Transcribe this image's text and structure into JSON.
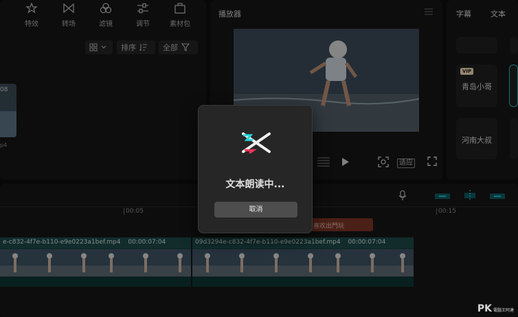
{
  "media": {
    "tools": [
      {
        "label": "特效",
        "icon": "sparkle-icon"
      },
      {
        "label": "转场",
        "icon": "transition-icon"
      },
      {
        "label": "滤镜",
        "icon": "filter-icon"
      },
      {
        "label": "调节",
        "icon": "sliders-icon"
      },
      {
        "label": "素材包",
        "icon": "package-icon"
      }
    ],
    "sort_label": "排序",
    "filter_label": "全部",
    "thumb_duration": "08",
    "thumb_name": "p4"
  },
  "player": {
    "title": "播放器",
    "fit_label": "适应"
  },
  "text_panel": {
    "tabs": [
      "字幕",
      "文本"
    ],
    "vip_badge": "VIP",
    "voices": [
      "青岛小哥",
      "河南大叔"
    ]
  },
  "timeline": {
    "ticks": [
      "00:05",
      "00:15"
    ],
    "text_clip_label": "喜欢出門玩",
    "clips": [
      {
        "name": "e-c832-4f7e-b110-e9e0223a1bef.mp4",
        "duration": "00:00:07:04"
      },
      {
        "name": "09d3294e-c832-4f7e-b110-e9e0223a1bef.mp4",
        "duration": "00:00:07:04"
      }
    ]
  },
  "dialog": {
    "message": "文本朗读中...",
    "cancel_label": "取消"
  },
  "watermark": {
    "main": "PK",
    "small": "電腦王阿達"
  },
  "colors": {
    "background": "#0d0d0d",
    "panel": "#151515",
    "clip_teal": "#143b3b",
    "text_clip": "#7a3526",
    "logo_cyan": "#2ad3dc",
    "logo_pink": "#f0355a"
  }
}
